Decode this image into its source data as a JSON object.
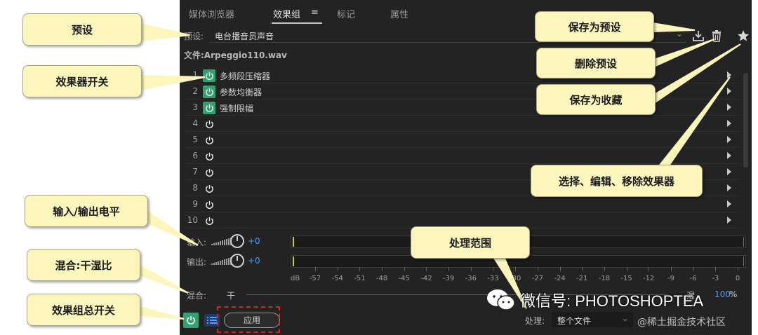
{
  "tabs": [
    {
      "label": "媒体浏览器",
      "active": false
    },
    {
      "label": "效果组",
      "active": true
    },
    {
      "label": "标记",
      "active": false
    },
    {
      "label": "属性",
      "active": false
    }
  ],
  "tab_menu_glyph": "≡",
  "preset": {
    "label": "预设:",
    "value": "电台播音员声音",
    "icons": [
      "chevron-down-icon",
      "save-preset-icon",
      "delete-preset-icon",
      "favorite-star-icon"
    ]
  },
  "file": {
    "label": "文件:Arpeggio110.wav"
  },
  "effect_slots": [
    {
      "num": "1",
      "name": "多频段压缩器",
      "on": true
    },
    {
      "num": "2",
      "name": "参数均衡器",
      "on": true
    },
    {
      "num": "3",
      "name": "强制限幅",
      "on": true
    },
    {
      "num": "4",
      "name": "",
      "on": false
    },
    {
      "num": "5",
      "name": "",
      "on": false
    },
    {
      "num": "6",
      "name": "",
      "on": false
    },
    {
      "num": "7",
      "name": "",
      "on": false
    },
    {
      "num": "8",
      "name": "",
      "on": false
    },
    {
      "num": "9",
      "name": "",
      "on": false
    },
    {
      "num": "10",
      "name": "",
      "on": false
    }
  ],
  "input_level": {
    "label": "输入:",
    "value": "+0"
  },
  "output_level": {
    "label": "输出:",
    "value": "+0"
  },
  "meter_scale": {
    "unit": "dB",
    "ticks": [
      "-57",
      "-54",
      "-51",
      "-48",
      "-45",
      "-42",
      "-39",
      "-36",
      "-33",
      "-30",
      "-27",
      "-24",
      "-21",
      "-18",
      "-15",
      "-12",
      "-9",
      "-6",
      "-3",
      "0"
    ]
  },
  "mix": {
    "label": "混合:",
    "dry": "干",
    "wet": "湿",
    "value": "100",
    "percent": "%"
  },
  "bottom": {
    "apply_label": "应用",
    "process_label": "处理:",
    "process_value": "整个文件"
  },
  "callouts": {
    "preset": "预设",
    "effect_switch": "效果器开关",
    "io_level": "输入/输出电平",
    "mix_ratio": "混合:干湿比",
    "master_switch": "效果组总开关",
    "save_preset": "保存为预设",
    "delete_preset": "删除预设",
    "save_favorite": "保存为收藏",
    "edit_effects": "选择、编辑、移除效果器",
    "process_range": "处理范围"
  },
  "watermark": {
    "text": "微信号: PHOTOSHOPTEA",
    "source": "@稀土掘金技术社区"
  },
  "colors": {
    "panel_bg": "#232323",
    "power_on": "#33a070",
    "value_blue": "#4d9bff",
    "callout_bg": "#fcf6bd",
    "highlight": "#e02020"
  }
}
